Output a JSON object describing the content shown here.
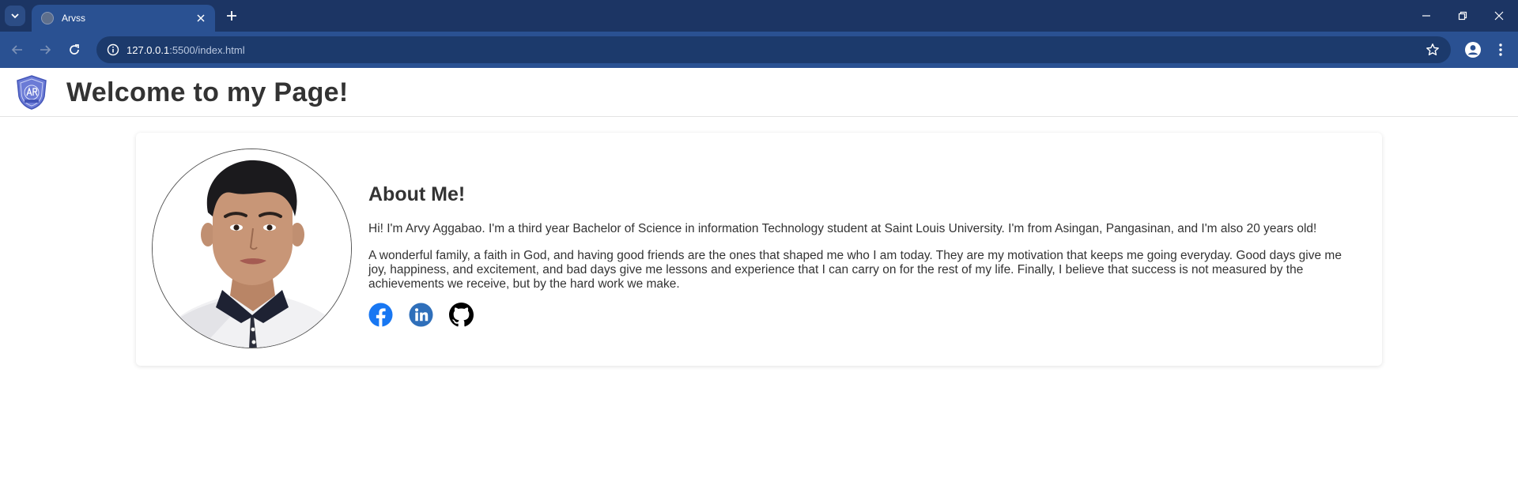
{
  "browser": {
    "tab_title": "Arvss",
    "url_host": "127.0.0.1",
    "url_rest": ":5500/index.html"
  },
  "header": {
    "title": "Welcome to my Page!",
    "logo_icon": "shield-logo-icon"
  },
  "about": {
    "heading": "About Me!",
    "paragraph_1": "Hi! I'm Arvy Aggabao. I'm a third year Bachelor of Science in information Technology student at Saint Louis University. I'm from Asingan, Pangasinan, and I'm also 20 years old!",
    "paragraph_2": "A wonderful family, a faith in God, and having good friends are the ones that shaped me who I am today. They are my motivation that keeps me going everyday. Good days give me joy, happiness, and excitement, and bad days give me lessons and experience that I can carry on for the rest of my life. Finally, I believe that success is not measured by the achievements we receive, but by the hard work we make."
  },
  "socials": [
    {
      "icon": "facebook-icon",
      "color": "#1877f2"
    },
    {
      "icon": "linkedin-icon",
      "color": "#2f6fba"
    },
    {
      "icon": "github-icon",
      "color": "#000000"
    }
  ],
  "colors": {
    "chrome_dark": "#1c3564",
    "chrome_mid": "#2a5192",
    "text": "#333333"
  }
}
